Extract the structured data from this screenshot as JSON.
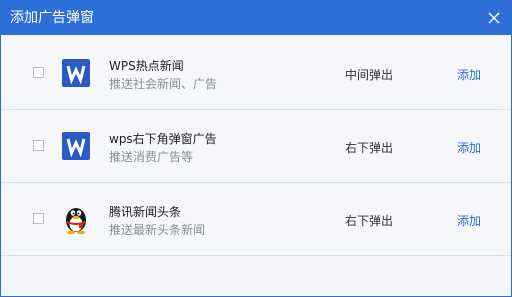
{
  "dialog": {
    "title": "添加广告弹窗",
    "close_icon": "close-icon"
  },
  "rows": [
    {
      "icon": "wps-logo-icon",
      "name": "WPS热点新闻",
      "desc": "推送社会新闻、广告",
      "mode": "中间弹出",
      "action": "添加",
      "checked": false
    },
    {
      "icon": "wps-logo-icon",
      "name": "wps右下角弹窗广告",
      "desc": "推送消费广告等",
      "mode": "右下弹出",
      "action": "添加",
      "checked": false
    },
    {
      "icon": "qq-penguin-icon",
      "name": "腾讯新闻头条",
      "desc": "推送最新头条新闻",
      "mode": "右下弹出",
      "action": "添加",
      "checked": false
    }
  ],
  "colors": {
    "titlebar": "#2c6fd8",
    "link": "#2b6fd0",
    "wps_icon": "#2a5bc5"
  }
}
